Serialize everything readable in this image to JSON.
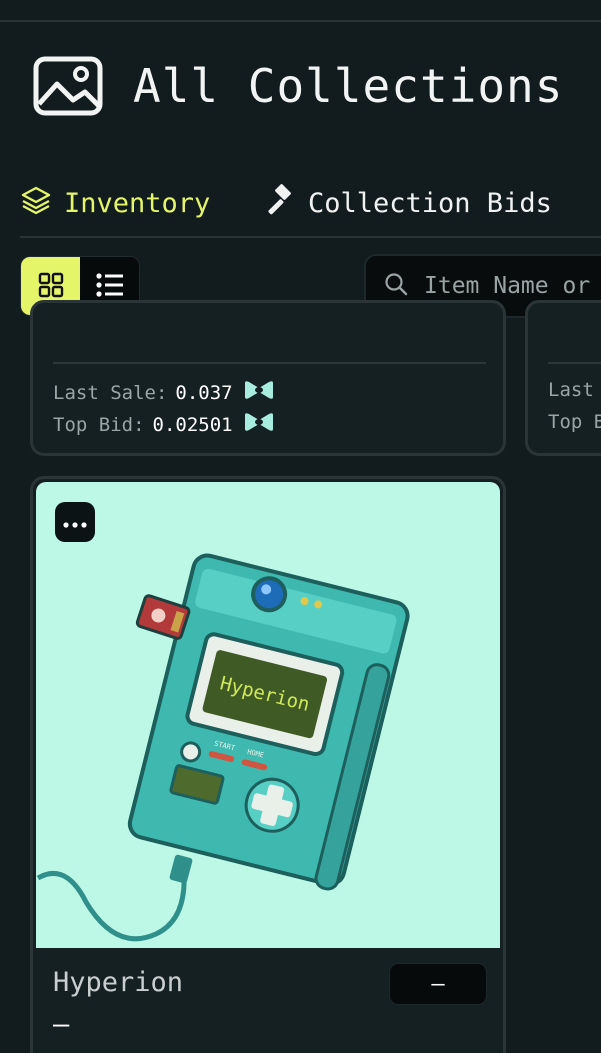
{
  "header": {
    "title": "All Collections",
    "icon": "image-icon"
  },
  "tabs": [
    {
      "label": "Inventory",
      "icon": "layers-icon",
      "active": true
    },
    {
      "label": "Collection Bids",
      "icon": "gavel-icon",
      "active": false
    }
  ],
  "view_toggle": {
    "grid_icon": "grid-icon",
    "list_icon": "list-icon",
    "active": "grid"
  },
  "search": {
    "placeholder": "Item Name or",
    "value": ""
  },
  "cards_top": [
    {
      "last_sale_label": "Last Sale:",
      "last_sale_value": "0.037",
      "top_bid_label": "Top Bid:",
      "top_bid_value": "0.02501",
      "currency_icon": "token-icon"
    },
    {
      "last_sale_label": "Last",
      "top_bid_label": "Top B"
    }
  ],
  "item_card": {
    "name": "Hyperion",
    "subtitle": "–",
    "price": "–",
    "image_screen_text": "Hyperion",
    "image_button_labels": [
      "START",
      "HOME"
    ],
    "menu_icon": "more-icon"
  },
  "colors": {
    "background": "#121b1d",
    "accent": "#e5f56a",
    "image_bg": "#bdf7e6",
    "device": "#3fb9b0"
  }
}
